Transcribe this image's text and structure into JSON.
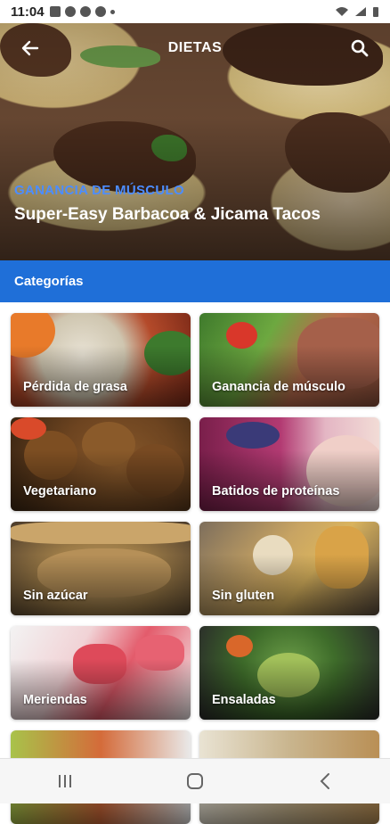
{
  "status_bar": {
    "time": "11:04",
    "icons": [
      "image-icon",
      "messenger-icon",
      "message-icon",
      "whatsapp-icon",
      "dot-icon"
    ],
    "right_icons": [
      "wifi-icon",
      "signal-icon",
      "battery-icon"
    ]
  },
  "app_bar": {
    "title": "DIETAS",
    "back_icon": "arrow-left-icon",
    "search_icon": "search-icon"
  },
  "hero": {
    "kicker": "GANANCIA DE MÚSCULO",
    "title": "Super-Easy Barbacoa & Jicama Tacos",
    "kicker_color": "#4c8dff"
  },
  "categories": {
    "header": "Categorías",
    "header_color": "#1f6fd8",
    "items": [
      {
        "label": "Pérdida de grasa"
      },
      {
        "label": "Ganancia de músculo"
      },
      {
        "label": "Vegetariano"
      },
      {
        "label": "Batidos de proteínas"
      },
      {
        "label": "Sin azúcar"
      },
      {
        "label": "Sin gluten"
      },
      {
        "label": "Meriendas"
      },
      {
        "label": "Ensaladas"
      },
      {
        "label": ""
      },
      {
        "label": ""
      }
    ]
  },
  "nav_bar": {
    "buttons": [
      "recent-apps-icon",
      "home-icon",
      "back-icon"
    ]
  }
}
